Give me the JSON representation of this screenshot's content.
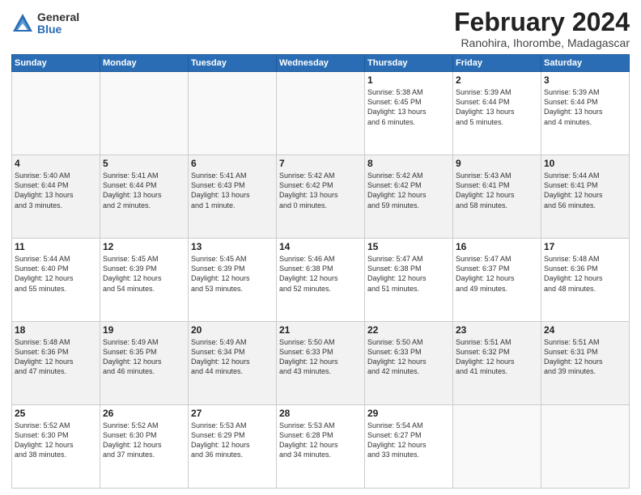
{
  "logo": {
    "general": "General",
    "blue": "Blue"
  },
  "header": {
    "month": "February 2024",
    "location": "Ranohira, Ihorombe, Madagascar"
  },
  "days": [
    "Sunday",
    "Monday",
    "Tuesday",
    "Wednesday",
    "Thursday",
    "Friday",
    "Saturday"
  ],
  "weeks": [
    [
      {
        "day": "",
        "content": ""
      },
      {
        "day": "",
        "content": ""
      },
      {
        "day": "",
        "content": ""
      },
      {
        "day": "",
        "content": ""
      },
      {
        "day": "1",
        "content": "Sunrise: 5:38 AM\nSunset: 6:45 PM\nDaylight: 13 hours\nand 6 minutes."
      },
      {
        "day": "2",
        "content": "Sunrise: 5:39 AM\nSunset: 6:44 PM\nDaylight: 13 hours\nand 5 minutes."
      },
      {
        "day": "3",
        "content": "Sunrise: 5:39 AM\nSunset: 6:44 PM\nDaylight: 13 hours\nand 4 minutes."
      }
    ],
    [
      {
        "day": "4",
        "content": "Sunrise: 5:40 AM\nSunset: 6:44 PM\nDaylight: 13 hours\nand 3 minutes."
      },
      {
        "day": "5",
        "content": "Sunrise: 5:41 AM\nSunset: 6:44 PM\nDaylight: 13 hours\nand 2 minutes."
      },
      {
        "day": "6",
        "content": "Sunrise: 5:41 AM\nSunset: 6:43 PM\nDaylight: 13 hours\nand 1 minute."
      },
      {
        "day": "7",
        "content": "Sunrise: 5:42 AM\nSunset: 6:42 PM\nDaylight: 13 hours\nand 0 minutes."
      },
      {
        "day": "8",
        "content": "Sunrise: 5:42 AM\nSunset: 6:42 PM\nDaylight: 12 hours\nand 59 minutes."
      },
      {
        "day": "9",
        "content": "Sunrise: 5:43 AM\nSunset: 6:41 PM\nDaylight: 12 hours\nand 58 minutes."
      },
      {
        "day": "10",
        "content": "Sunrise: 5:44 AM\nSunset: 6:41 PM\nDaylight: 12 hours\nand 56 minutes."
      }
    ],
    [
      {
        "day": "11",
        "content": "Sunrise: 5:44 AM\nSunset: 6:40 PM\nDaylight: 12 hours\nand 55 minutes."
      },
      {
        "day": "12",
        "content": "Sunrise: 5:45 AM\nSunset: 6:39 PM\nDaylight: 12 hours\nand 54 minutes."
      },
      {
        "day": "13",
        "content": "Sunrise: 5:45 AM\nSunset: 6:39 PM\nDaylight: 12 hours\nand 53 minutes."
      },
      {
        "day": "14",
        "content": "Sunrise: 5:46 AM\nSunset: 6:38 PM\nDaylight: 12 hours\nand 52 minutes."
      },
      {
        "day": "15",
        "content": "Sunrise: 5:47 AM\nSunset: 6:38 PM\nDaylight: 12 hours\nand 51 minutes."
      },
      {
        "day": "16",
        "content": "Sunrise: 5:47 AM\nSunset: 6:37 PM\nDaylight: 12 hours\nand 49 minutes."
      },
      {
        "day": "17",
        "content": "Sunrise: 5:48 AM\nSunset: 6:36 PM\nDaylight: 12 hours\nand 48 minutes."
      }
    ],
    [
      {
        "day": "18",
        "content": "Sunrise: 5:48 AM\nSunset: 6:36 PM\nDaylight: 12 hours\nand 47 minutes."
      },
      {
        "day": "19",
        "content": "Sunrise: 5:49 AM\nSunset: 6:35 PM\nDaylight: 12 hours\nand 46 minutes."
      },
      {
        "day": "20",
        "content": "Sunrise: 5:49 AM\nSunset: 6:34 PM\nDaylight: 12 hours\nand 44 minutes."
      },
      {
        "day": "21",
        "content": "Sunrise: 5:50 AM\nSunset: 6:33 PM\nDaylight: 12 hours\nand 43 minutes."
      },
      {
        "day": "22",
        "content": "Sunrise: 5:50 AM\nSunset: 6:33 PM\nDaylight: 12 hours\nand 42 minutes."
      },
      {
        "day": "23",
        "content": "Sunrise: 5:51 AM\nSunset: 6:32 PM\nDaylight: 12 hours\nand 41 minutes."
      },
      {
        "day": "24",
        "content": "Sunrise: 5:51 AM\nSunset: 6:31 PM\nDaylight: 12 hours\nand 39 minutes."
      }
    ],
    [
      {
        "day": "25",
        "content": "Sunrise: 5:52 AM\nSunset: 6:30 PM\nDaylight: 12 hours\nand 38 minutes."
      },
      {
        "day": "26",
        "content": "Sunrise: 5:52 AM\nSunset: 6:30 PM\nDaylight: 12 hours\nand 37 minutes."
      },
      {
        "day": "27",
        "content": "Sunrise: 5:53 AM\nSunset: 6:29 PM\nDaylight: 12 hours\nand 36 minutes."
      },
      {
        "day": "28",
        "content": "Sunrise: 5:53 AM\nSunset: 6:28 PM\nDaylight: 12 hours\nand 34 minutes."
      },
      {
        "day": "29",
        "content": "Sunrise: 5:54 AM\nSunset: 6:27 PM\nDaylight: 12 hours\nand 33 minutes."
      },
      {
        "day": "",
        "content": ""
      },
      {
        "day": "",
        "content": ""
      }
    ]
  ]
}
